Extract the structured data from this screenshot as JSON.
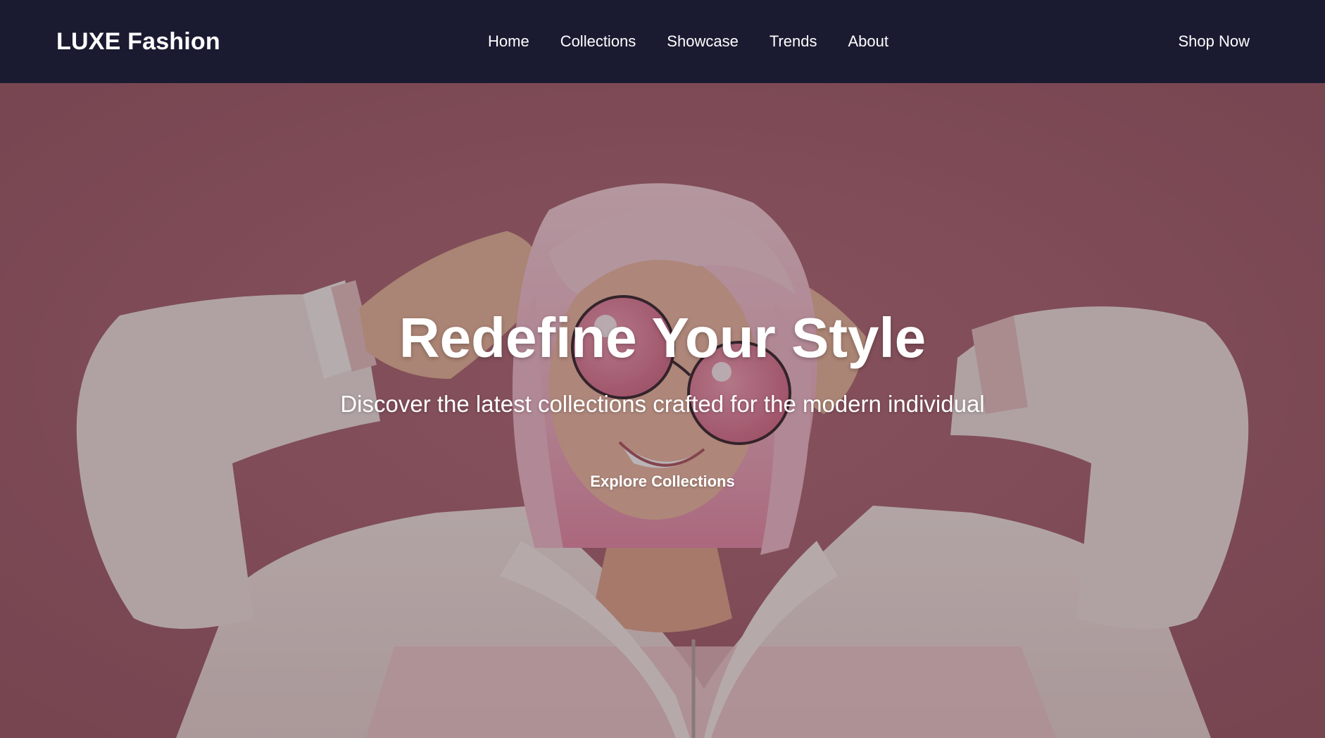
{
  "brand": {
    "name": "LUXE Fashion"
  },
  "nav": {
    "links": [
      {
        "label": "Home"
      },
      {
        "label": "Collections"
      },
      {
        "label": "Showcase"
      },
      {
        "label": "Trends"
      },
      {
        "label": "About"
      }
    ],
    "cta_label": "Shop Now"
  },
  "hero": {
    "title": "Redefine Your Style",
    "subtitle": "Discover the latest collections crafted for the modern individual",
    "cta_label": "Explore Collections",
    "image_subject": "woman-with-pink-hair-and-pink-round-sunglasses"
  },
  "colors": {
    "navbar_bg": "#1a1b31",
    "hero_bg": "#8a5660",
    "text": "#ffffff"
  }
}
